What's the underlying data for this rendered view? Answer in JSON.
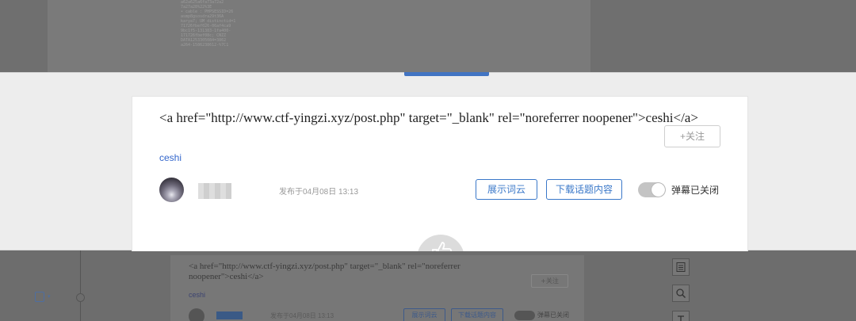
{
  "background_page": {
    "top_text_lines": [
      "a62a625a6fa73a72a2",
      "7a27a28%22%3E",
      "• cable : PHPSESSID=26",
      "asmp8gsosdra29t36A",
      "karya7; UM_distinctid=1",
      "71726fbef026-06af4ca9",
      "9bc1f5-131383-1fa400-",
      "171726fbef08c; CNZZ",
      "DATA1253305084=3862",
      "a264-1586238612-%7C1"
    ],
    "code_text": "<a href=\"http://www.ctf-yingzi.xyz/post.php\" target=\"_blank\" rel=\"noreferrer\nnoopener\">ceshi</a>",
    "follow": "+关注",
    "ceshi": "ceshi",
    "date": "发布于04月08日 13:13",
    "btn_wordcloud": "展示词云",
    "btn_download": "下载话题内容",
    "danmu": "弹幕已关闭"
  },
  "card": {
    "title": "<a href=\"http://www.ctf-yingzi.xyz/post.php\" target=\"_blank\" rel=\"noreferrer noopener\">ceshi</a>",
    "follow_label": "+关注",
    "body_link": "ceshi",
    "publish_time": "发布于04月08日  13:13",
    "show_wordcloud": "展示词云",
    "download_topic": "下载话题内容",
    "danmu_toggle_on": false,
    "danmu_label": "弹幕已关闭"
  },
  "colors": {
    "accent": "#3a78c9",
    "tab_indicator": "#4274c2",
    "link": "#3366cc"
  },
  "icons": {
    "fab": "thumbs-up-icon",
    "side_1": "document-icon",
    "side_2": "magnifier-icon",
    "side_3": "text-icon"
  }
}
